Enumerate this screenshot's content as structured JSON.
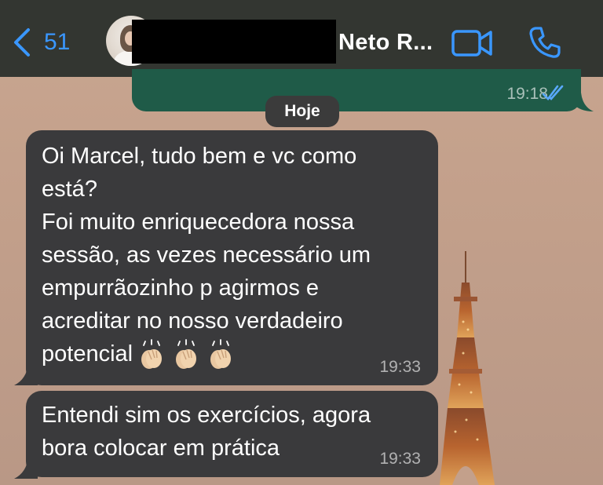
{
  "header": {
    "back_count": "51",
    "contact_name": "Neto R...",
    "icons": {
      "back": "chevron-left-icon",
      "video": "video-camera-icon",
      "phone": "phone-icon"
    },
    "accent_color": "#3a97ff"
  },
  "conversation": {
    "outgoing_previous": {
      "time": "19:18",
      "status": "read"
    },
    "date_separator": "Hoje",
    "messages": [
      {
        "direction": "incoming",
        "text": "Oi Marcel, tudo bem e vc como\nestá?\nFoi muito enriquecedora nossa\nsessão, as vezes necessário um\nempurrãozinho p agirmos e\nacreditar no nosso verdadeiro\npotencial",
        "emoji": "clapping-hands x3",
        "time": "19:33"
      },
      {
        "direction": "incoming",
        "text": "Entendi sim os exercícios, agora\nbora colocar em prática",
        "time": "19:33"
      }
    ]
  },
  "colors": {
    "incoming_bubble": "#3a3a3c",
    "outgoing_bubble": "#1f5b48",
    "header_bg": "#282d2a"
  }
}
